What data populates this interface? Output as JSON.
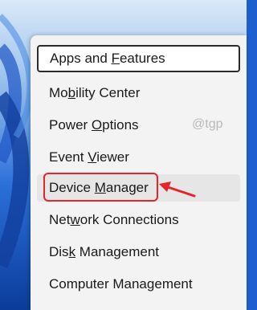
{
  "menu": {
    "items": [
      {
        "pre": "Apps and ",
        "key": "F",
        "post": "eatures"
      },
      {
        "pre": "Mo",
        "key": "b",
        "post": "ility Center"
      },
      {
        "pre": "Power ",
        "key": "O",
        "post": "ptions"
      },
      {
        "pre": "Event ",
        "key": "V",
        "post": "iewer"
      },
      {
        "pre": "Device ",
        "key": "M",
        "post": "anager"
      },
      {
        "pre": "Net",
        "key": "w",
        "post": "ork Connections"
      },
      {
        "pre": "Dis",
        "key": "k",
        "post": " Management"
      },
      {
        "pre": "Computer Mana",
        "key": "g",
        "post": "ement"
      }
    ]
  },
  "watermark": "@tgp",
  "colors": {
    "highlight_border": "#e5252b",
    "arrow": "#e5252b",
    "menu_background": "#f3f3f3",
    "wallpaper": "#1e5fd0"
  }
}
